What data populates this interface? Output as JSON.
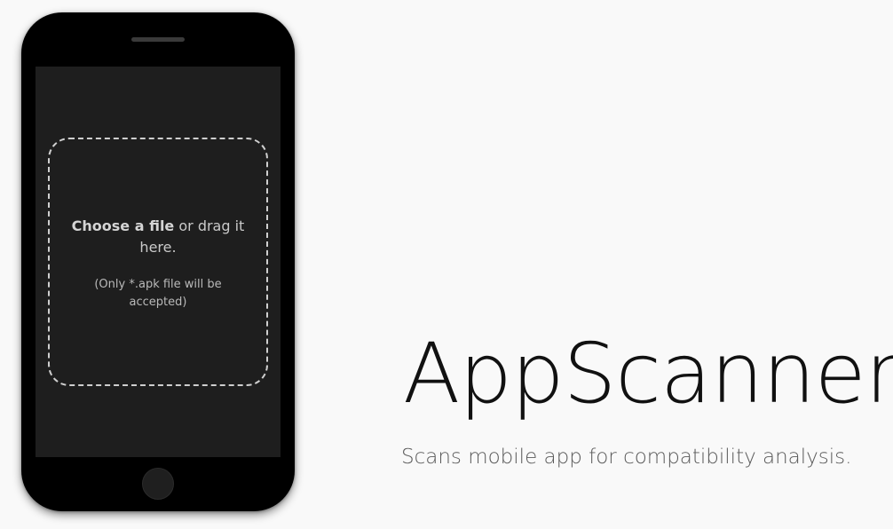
{
  "phone": {
    "dropzone": {
      "choose_label": "Choose a file",
      "rest_label": " or drag it here.",
      "note": "(Only *.apk file will be accepted)"
    },
    "home_button_icon": "circle-home-button"
  },
  "hero": {
    "title": "AppScanner",
    "subtitle": "Scans mobile app for compatibility analysis."
  },
  "colors": {
    "page_background": "#f9f9f9",
    "phone_body": "#000000",
    "screen": "#1e1e1e",
    "dropzone_border": "#cfcfcf",
    "title_text": "#111111",
    "subtitle_text": "#5a5a5a"
  }
}
